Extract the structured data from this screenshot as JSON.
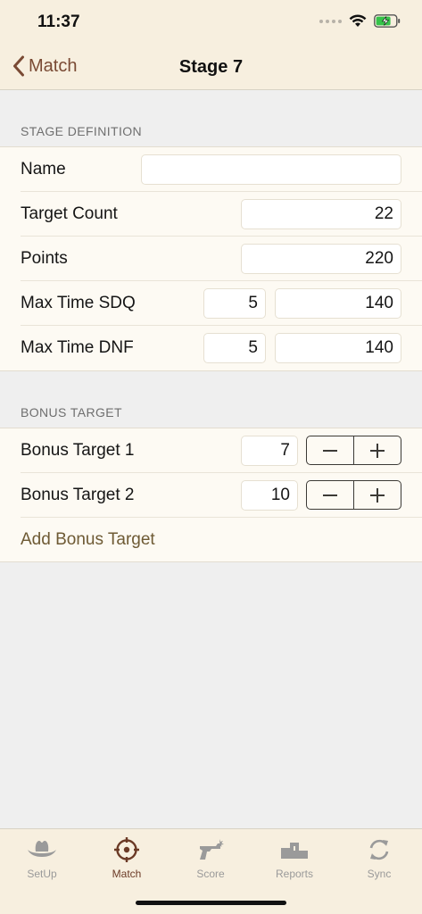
{
  "status": {
    "time": "11:37"
  },
  "nav": {
    "back_label": "Match",
    "title": "Stage 7"
  },
  "sections": {
    "stage_definition": "STAGE DEFINITION",
    "bonus_target": "BONUS TARGET"
  },
  "stage": {
    "name": {
      "label": "Name",
      "value": ""
    },
    "target_count": {
      "label": "Target Count",
      "value": "22"
    },
    "points": {
      "label": "Points",
      "value": "220"
    },
    "max_time_sdq": {
      "label": "Max Time SDQ",
      "value1": "5",
      "value2": "140"
    },
    "max_time_dnf": {
      "label": "Max Time DNF",
      "value1": "5",
      "value2": "140"
    }
  },
  "bonus": {
    "items": [
      {
        "label": "Bonus Target 1",
        "value": "7"
      },
      {
        "label": "Bonus Target 2",
        "value": "10"
      }
    ],
    "add_label": "Add Bonus Target"
  },
  "tabs": [
    {
      "label": "SetUp",
      "icon": "cowboy-hat-icon",
      "active": false
    },
    {
      "label": "Match",
      "icon": "crosshair-icon",
      "active": true
    },
    {
      "label": "Score",
      "icon": "revolver-icon",
      "active": false
    },
    {
      "label": "Reports",
      "icon": "podium-icon",
      "active": false
    },
    {
      "label": "Sync",
      "icon": "sync-icon",
      "active": false
    }
  ],
  "colors": {
    "accent": "#7a4a34",
    "bar_background": "#f7efdf",
    "group_background": "#fdfaf3",
    "page_background": "#efefef",
    "add_link": "#6e5a34"
  }
}
